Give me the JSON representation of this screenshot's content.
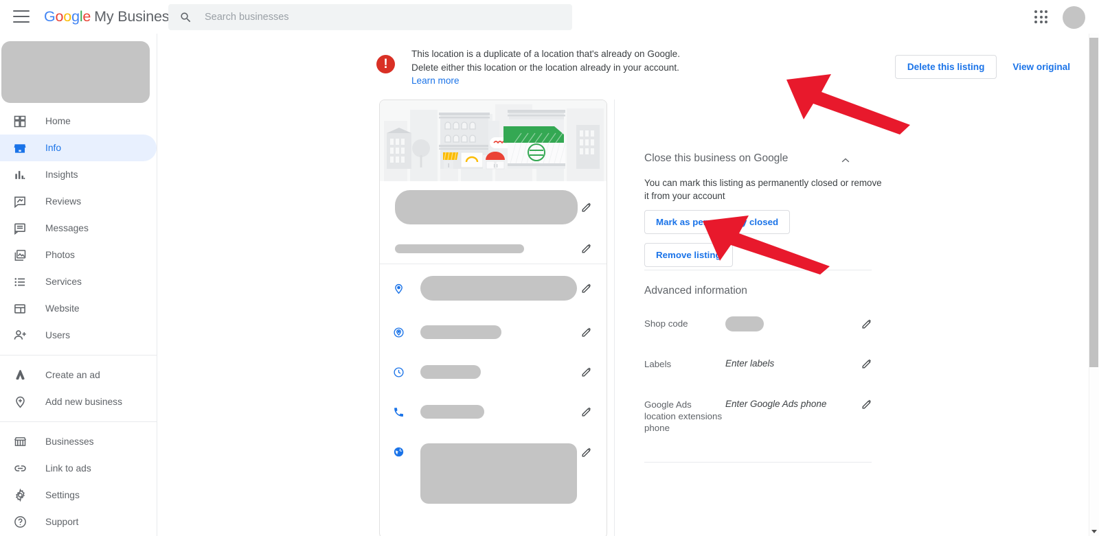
{
  "topbar": {
    "menu_icon": "hamburger-menu-icon",
    "brand_google": "Google",
    "brand_suffix": "My Business",
    "search_placeholder": "Search businesses",
    "search_value": "",
    "search_icon": "search-icon",
    "apps_icon": "apps-grid-icon",
    "avatar_icon": "account-avatar"
  },
  "sidebar": {
    "groups": [
      {
        "items": [
          {
            "label": "Home",
            "icon": "dashboard-icon",
            "active": false
          },
          {
            "label": "Info",
            "icon": "storefront-icon",
            "active": true
          },
          {
            "label": "Insights",
            "icon": "bar-chart-icon",
            "active": false
          },
          {
            "label": "Reviews",
            "icon": "review-icon",
            "active": false
          },
          {
            "label": "Messages",
            "icon": "message-icon",
            "active": false
          },
          {
            "label": "Photos",
            "icon": "photo-library-icon",
            "active": false
          },
          {
            "label": "Services",
            "icon": "list-icon",
            "active": false
          },
          {
            "label": "Website",
            "icon": "web-page-icon",
            "active": false
          },
          {
            "label": "Users",
            "icon": "add-user-icon",
            "active": false
          }
        ]
      },
      {
        "items": [
          {
            "label": "Create an ad",
            "icon": "google-ads-icon",
            "active": false
          },
          {
            "label": "Add new business",
            "icon": "add-location-icon",
            "active": false
          }
        ]
      },
      {
        "items": [
          {
            "label": "Businesses",
            "icon": "store-icon",
            "active": false
          },
          {
            "label": "Link to ads",
            "icon": "link-icon",
            "active": false
          },
          {
            "label": "Settings",
            "icon": "gear-icon",
            "active": false
          },
          {
            "label": "Support",
            "icon": "help-icon",
            "active": false
          }
        ]
      }
    ]
  },
  "alert": {
    "icon": "error-exclamation-icon",
    "line1": "This location is a duplicate of a location that's already on Google.",
    "line2": "Delete either this location or the location already in your account.",
    "learn_more": "Learn more",
    "delete_button": "Delete this listing",
    "view_original_button": "View original"
  },
  "card": {
    "hero_icon": "storefront-illustration",
    "rows": [
      {
        "icon": "business-name-placeholder",
        "edit": "edit-pencil-icon"
      },
      {
        "icon": "business-category-placeholder",
        "edit": "edit-pencil-icon"
      },
      {
        "icon": "location-pin-icon",
        "edit": "edit-pencil-icon"
      },
      {
        "icon": "service-area-icon",
        "edit": "edit-pencil-icon"
      },
      {
        "icon": "clock-hours-icon",
        "edit": "edit-pencil-icon"
      },
      {
        "icon": "phone-icon",
        "edit": "edit-pencil-icon"
      },
      {
        "icon": "website-globe-icon",
        "edit": "edit-pencil-icon"
      }
    ]
  },
  "close_business": {
    "title": "Close this business on Google",
    "collapse_icon": "chevron-up-icon",
    "description": "You can mark this listing as permanently closed or remove it from your account",
    "mark_closed_button": "Mark as permanently closed",
    "remove_listing_button": "Remove listing"
  },
  "advanced": {
    "title": "Advanced information",
    "rows": [
      {
        "label": "Shop code",
        "value": "",
        "value_is_placeholder_bar": true,
        "edit": "edit-pencil-icon"
      },
      {
        "label": "Labels",
        "value": "Enter labels",
        "value_is_placeholder_bar": false,
        "edit": "edit-pencil-icon"
      },
      {
        "label": "Google Ads location extensions phone",
        "value": "Enter Google Ads phone",
        "value_is_placeholder_bar": false,
        "edit": "edit-pencil-icon"
      }
    ]
  },
  "annotations": {
    "arrow_1": "red-arrow-pointing-to-delete-this-listing",
    "arrow_2": "red-arrow-pointing-to-remove-listing"
  },
  "colors": {
    "brand_blue": "#1a73e8",
    "error_red": "#d93025",
    "annotation_red": "#e8192c",
    "placeholder_gray": "#c4c4c4",
    "active_nav_bg": "#e8f0fe"
  },
  "scrollbar": {
    "name": "page-scrollbar"
  }
}
